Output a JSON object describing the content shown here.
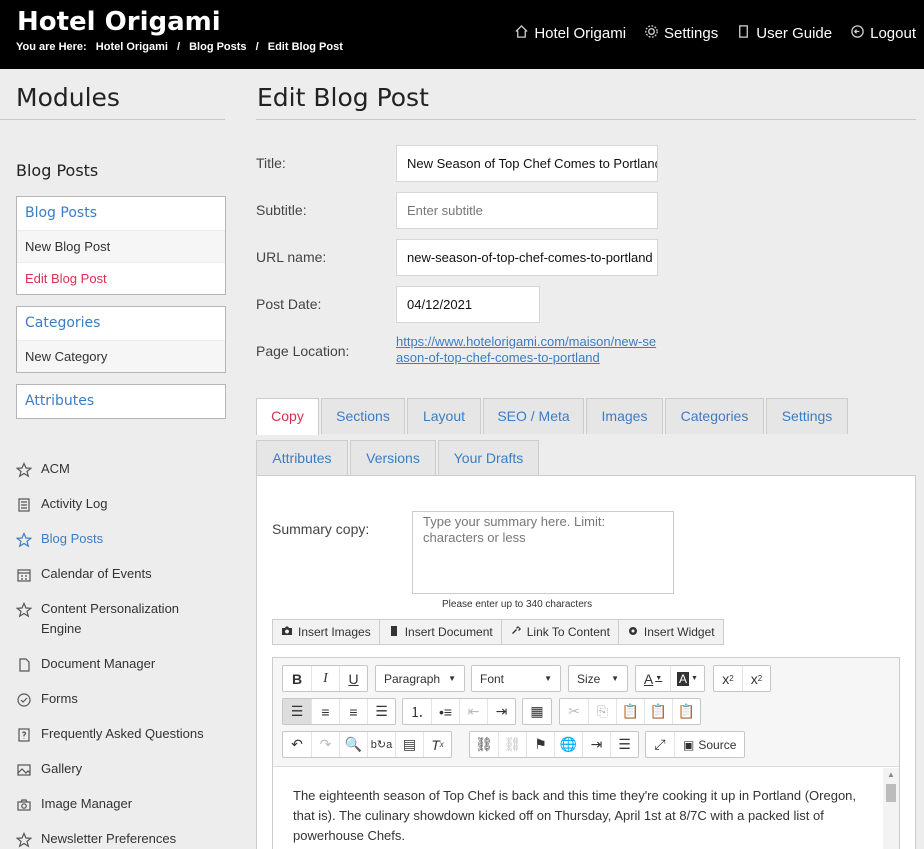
{
  "header": {
    "brand": "Hotel Origami",
    "breadcrumb_prefix": "You are Here:",
    "breadcrumbs": [
      "Hotel Origami",
      "Blog Posts",
      "Edit Blog Post"
    ],
    "nav": [
      {
        "label": "Hotel Origami",
        "icon": "home-icon"
      },
      {
        "label": "Settings",
        "icon": "gear-icon"
      },
      {
        "label": "User Guide",
        "icon": "document-icon"
      },
      {
        "label": "Logout",
        "icon": "logout-icon"
      }
    ]
  },
  "sidebar": {
    "title": "Modules",
    "subtitle": "Blog Posts",
    "boxes": [
      {
        "heading": "Blog Posts",
        "items": [
          "New Blog Post",
          "Edit Blog Post"
        ]
      },
      {
        "heading": "Categories",
        "items": [
          "New Category"
        ]
      },
      {
        "heading": "Attributes",
        "items": []
      }
    ],
    "modules": [
      {
        "label": "ACM",
        "icon": "star-icon"
      },
      {
        "label": "Activity Log",
        "icon": "log-icon"
      },
      {
        "label": "Blog Posts",
        "icon": "star-icon"
      },
      {
        "label": "Calendar of Events",
        "icon": "calendar-icon"
      },
      {
        "label": "Content Personalization Engine",
        "icon": "star-icon"
      },
      {
        "label": "Document Manager",
        "icon": "document-icon"
      },
      {
        "label": "Forms",
        "icon": "check-circle-icon"
      },
      {
        "label": "Frequently Asked Questions",
        "icon": "question-icon"
      },
      {
        "label": "Gallery",
        "icon": "image-icon"
      },
      {
        "label": "Image Manager",
        "icon": "camera-icon"
      },
      {
        "label": "Newsletter Preferences",
        "icon": "star-icon"
      }
    ]
  },
  "main": {
    "title": "Edit Blog Post",
    "fields": {
      "title_label": "Title:",
      "title_value": "New Season of Top Chef Comes to Portland",
      "subtitle_label": "Subtitle:",
      "subtitle_placeholder": "Enter subtitle",
      "url_label": "URL name:",
      "url_value": "new-season-of-top-chef-comes-to-portland",
      "date_label": "Post Date:",
      "date_value": "04/12/2021",
      "location_label": "Page Location:",
      "location_link": "https://www.hotelorigami.com/maison/new-season-of-top-chef-comes-to-portland"
    },
    "tabs_row1": [
      "Copy",
      "Sections",
      "Layout",
      "SEO / Meta",
      "Images",
      "Categories",
      "Settings"
    ],
    "tabs_row2": [
      "Attributes",
      "Versions",
      "Your Drafts"
    ],
    "active_tab": "Copy",
    "summary": {
      "label": "Summary copy:",
      "placeholder": "Type your summary here. Limit: characters or less",
      "hint": "Please enter up to 340 characters"
    },
    "insert_bar": [
      "Insert Images",
      "Insert Document",
      "Link To Content",
      "Insert Widget"
    ],
    "editor": {
      "format_select": "Paragraph",
      "font_select": "Font",
      "size_select": "Size",
      "source_label": "Source",
      "body": "The eighteenth season of Top Chef is back and this time they're cooking it up in Portland (Oregon, that is). The culinary showdown kicked off on Thursday, April 1st at 8/7C with a packed list of powerhouse Chefs."
    }
  },
  "colors": {
    "accent": "#3b7dc4",
    "active": "#d6324f",
    "header_bg": "#000000"
  }
}
